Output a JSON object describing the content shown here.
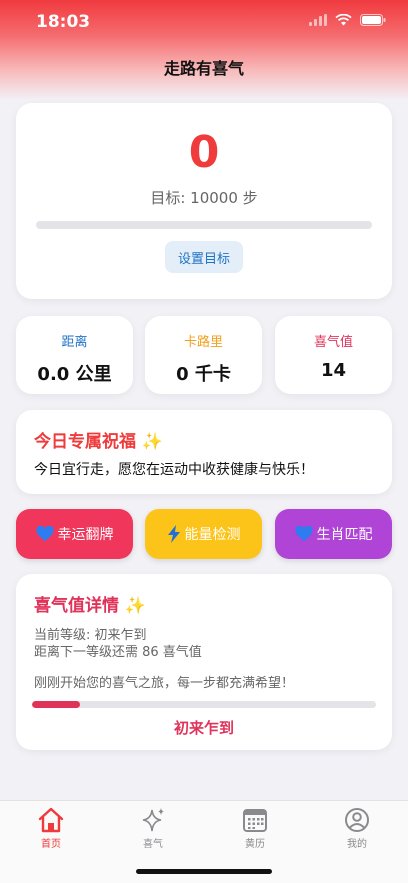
{
  "status_bar": {
    "time": "18:03"
  },
  "header": {
    "title": "走路有喜气"
  },
  "steps": {
    "value": "0",
    "goal_text": "目标: 10000 步",
    "progress": 0,
    "set_goal_label": "设置目标"
  },
  "stats": [
    {
      "label": "距离",
      "value": "0.0 公里",
      "color": "#1f73c4"
    },
    {
      "label": "卡路里",
      "value": "0 千卡",
      "color": "#f0a020"
    },
    {
      "label": "喜气值",
      "value": "14",
      "color": "#e0335a"
    }
  ],
  "blessing": {
    "title": "今日专属祝福",
    "title_sparkle": "✨",
    "text": "今日宜行走，愿您在运动中收获健康与快乐！"
  },
  "actions": [
    {
      "label": "幸运翻牌",
      "icon": "heart-icon",
      "color": "#f0365a"
    },
    {
      "label": "能量检测",
      "icon": "bolt-icon",
      "color": "#fcc419"
    },
    {
      "label": "生肖匹配",
      "icon": "heart-icon",
      "color": "#b044d6"
    }
  ],
  "joy_detail": {
    "title": "喜气值详情",
    "title_sparkle": "✨",
    "current_level_line": "当前等级: 初来乍到",
    "next_level_line": "距离下一等级还需 86 喜气值",
    "encouragement": "刚刚开始您的喜气之旅，每一步都充满希望！",
    "progress": 0.14,
    "level_name": "初来乍到"
  },
  "tab_bar": {
    "items": [
      {
        "label": "首页",
        "icon": "home-icon",
        "active": true
      },
      {
        "label": "喜气",
        "icon": "sparkle-icon",
        "active": false
      },
      {
        "label": "黄历",
        "icon": "calendar-icon",
        "active": false
      },
      {
        "label": "我的",
        "icon": "profile-icon",
        "active": false
      }
    ]
  },
  "colors": {
    "accent": "#ef3b3b",
    "joy": "#e0335a",
    "tab_active": "#ef3b3b",
    "tab_inactive": "#8a8a8e"
  }
}
